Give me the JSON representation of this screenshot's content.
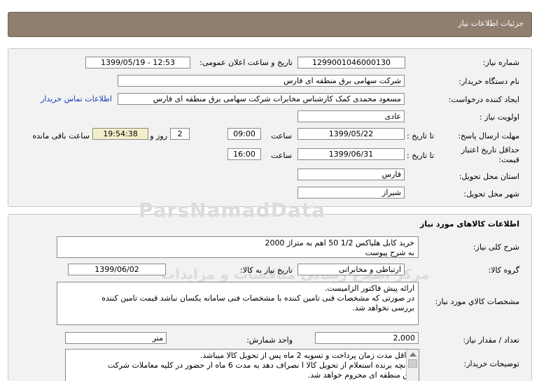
{
  "header": {
    "title": "جزئیات اطلاعات نیاز"
  },
  "info": {
    "need_number_label": "شماره نیاز:",
    "need_number": "1299001046000130",
    "announce_label": "تاریخ و ساعت اعلان عمومی:",
    "announce_value": "1399/05/19 - 12:53",
    "buyer_label": "نام دستگاه خریدار:",
    "buyer_value": "شرکت سهامی برق منطقه ای فارس",
    "creator_label": "ایجاد کننده درخواست:",
    "creator_value": "مسعود محمدی کمک کارشناس مخابرات شرکت سهامی برق منطقه ای فارس",
    "contact_link": "اطلاعات تماس خریدار",
    "priority_label": "اولویت نیاز :",
    "priority_value": "عادی",
    "deadline_label": "مهلت ارسال پاسخ:",
    "to_date_label": "تا تاریخ :",
    "deadline_date": "1399/05/22",
    "time_label": "ساعت",
    "deadline_time": "09:00",
    "days_value": "2",
    "day_and_label": "روز و",
    "remaining_time": "19:54:38",
    "remaining_label": "ساعت باقی مانده",
    "validity_label": "حداقل تاریخ اعتبار قیمت:",
    "validity_to_label": "تا تاریخ :",
    "validity_date": "1399/06/31",
    "validity_time_label": "ساعت",
    "validity_time": "16:00",
    "province_label": "استان محل تحویل:",
    "province_value": "فارس",
    "city_label": "شهر محل تحویل:",
    "city_value": "شیراز"
  },
  "goods": {
    "section_title": "اطلاعات کالاهای مورد نیاز",
    "desc_label": "شرح کلی نیاز:",
    "desc_line1": "خرید کابل هلیاکس 1/2  50 اهم به متراژ 2000",
    "desc_line2": "به شرح پیوست",
    "group_label": "گروه کالا:",
    "group_value": "ارتباطی و مخابراتی",
    "need_date_label": "تاریخ نیاز به کالا:",
    "need_date": "1399/06/02",
    "specs_label": "مشخصات کالاي مورد نياز:",
    "specs_line1": "ارائه پیش فاکتور الزامیست.",
    "specs_line2": "در صورتی که مشخصات فنی تامین کننده با مشخصات فنی سامانه یکسان نباشد قیمت  تامین کننده",
    "specs_line3": "بررسی نخواهد شد.",
    "qty_label": "تعداد / مقدار نیاز:",
    "qty_value": "2,000",
    "unit_label": "واحد شمارش:",
    "unit_value": "متر",
    "notes_label": "توضیحات خریدار:",
    "notes_line1": "حداقل مدت زمان پرداخت و تسویه 2 ماه پس از تحویل کالا میباشد.",
    "notes_line2": "چنانچه برنده استعلام از تحویل کالا ا نصراف دهد به مدت 6 ماه از حضور در کلیه معاملات شرکت",
    "notes_line3": "برق منطقه ای محروم خواهد شد."
  },
  "watermark": {
    "brand": "ParsNamadData",
    "subtitle": "پارس نماد داده ها",
    "subtitle2": "مرکز اطلاع رسانی مناقصات و مزایدات",
    "phone": "۰۲۱ - ۸۸۳۴۹۶۷۰"
  },
  "colors": {
    "header_bg": "#8f7f6f",
    "panel_bg": "#f2f2f2",
    "remaining_bg": "#f3efc8",
    "link": "#1a3fb5"
  }
}
